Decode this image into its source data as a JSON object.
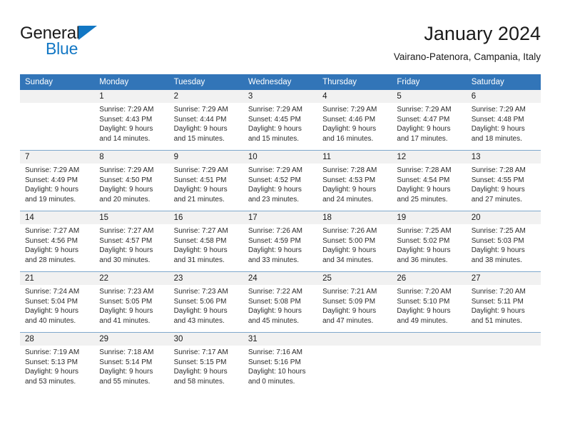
{
  "brand": {
    "name_part1": "General",
    "name_part2": "Blue",
    "triangle_color": "#1277c4",
    "text_color": "#1a1a1a"
  },
  "header": {
    "title": "January 2024",
    "subtitle": "Vairano-Patenora, Campania, Italy"
  },
  "theme": {
    "header_blue": "#3275b8",
    "daynum_band": "#f1f1f1",
    "row_separator": "#7fa8cc"
  },
  "weekday_headers": [
    "Sunday",
    "Monday",
    "Tuesday",
    "Wednesday",
    "Thursday",
    "Friday",
    "Saturday"
  ],
  "weeks": [
    [
      {
        "day": "",
        "sunrise": "",
        "sunset": "",
        "daylight_line1": "",
        "daylight_line2": ""
      },
      {
        "day": "1",
        "sunrise": "Sunrise: 7:29 AM",
        "sunset": "Sunset: 4:43 PM",
        "daylight_line1": "Daylight: 9 hours",
        "daylight_line2": "and 14 minutes."
      },
      {
        "day": "2",
        "sunrise": "Sunrise: 7:29 AM",
        "sunset": "Sunset: 4:44 PM",
        "daylight_line1": "Daylight: 9 hours",
        "daylight_line2": "and 15 minutes."
      },
      {
        "day": "3",
        "sunrise": "Sunrise: 7:29 AM",
        "sunset": "Sunset: 4:45 PM",
        "daylight_line1": "Daylight: 9 hours",
        "daylight_line2": "and 15 minutes."
      },
      {
        "day": "4",
        "sunrise": "Sunrise: 7:29 AM",
        "sunset": "Sunset: 4:46 PM",
        "daylight_line1": "Daylight: 9 hours",
        "daylight_line2": "and 16 minutes."
      },
      {
        "day": "5",
        "sunrise": "Sunrise: 7:29 AM",
        "sunset": "Sunset: 4:47 PM",
        "daylight_line1": "Daylight: 9 hours",
        "daylight_line2": "and 17 minutes."
      },
      {
        "day": "6",
        "sunrise": "Sunrise: 7:29 AM",
        "sunset": "Sunset: 4:48 PM",
        "daylight_line1": "Daylight: 9 hours",
        "daylight_line2": "and 18 minutes."
      }
    ],
    [
      {
        "day": "7",
        "sunrise": "Sunrise: 7:29 AM",
        "sunset": "Sunset: 4:49 PM",
        "daylight_line1": "Daylight: 9 hours",
        "daylight_line2": "and 19 minutes."
      },
      {
        "day": "8",
        "sunrise": "Sunrise: 7:29 AM",
        "sunset": "Sunset: 4:50 PM",
        "daylight_line1": "Daylight: 9 hours",
        "daylight_line2": "and 20 minutes."
      },
      {
        "day": "9",
        "sunrise": "Sunrise: 7:29 AM",
        "sunset": "Sunset: 4:51 PM",
        "daylight_line1": "Daylight: 9 hours",
        "daylight_line2": "and 21 minutes."
      },
      {
        "day": "10",
        "sunrise": "Sunrise: 7:29 AM",
        "sunset": "Sunset: 4:52 PM",
        "daylight_line1": "Daylight: 9 hours",
        "daylight_line2": "and 23 minutes."
      },
      {
        "day": "11",
        "sunrise": "Sunrise: 7:28 AM",
        "sunset": "Sunset: 4:53 PM",
        "daylight_line1": "Daylight: 9 hours",
        "daylight_line2": "and 24 minutes."
      },
      {
        "day": "12",
        "sunrise": "Sunrise: 7:28 AM",
        "sunset": "Sunset: 4:54 PM",
        "daylight_line1": "Daylight: 9 hours",
        "daylight_line2": "and 25 minutes."
      },
      {
        "day": "13",
        "sunrise": "Sunrise: 7:28 AM",
        "sunset": "Sunset: 4:55 PM",
        "daylight_line1": "Daylight: 9 hours",
        "daylight_line2": "and 27 minutes."
      }
    ],
    [
      {
        "day": "14",
        "sunrise": "Sunrise: 7:27 AM",
        "sunset": "Sunset: 4:56 PM",
        "daylight_line1": "Daylight: 9 hours",
        "daylight_line2": "and 28 minutes."
      },
      {
        "day": "15",
        "sunrise": "Sunrise: 7:27 AM",
        "sunset": "Sunset: 4:57 PM",
        "daylight_line1": "Daylight: 9 hours",
        "daylight_line2": "and 30 minutes."
      },
      {
        "day": "16",
        "sunrise": "Sunrise: 7:27 AM",
        "sunset": "Sunset: 4:58 PM",
        "daylight_line1": "Daylight: 9 hours",
        "daylight_line2": "and 31 minutes."
      },
      {
        "day": "17",
        "sunrise": "Sunrise: 7:26 AM",
        "sunset": "Sunset: 4:59 PM",
        "daylight_line1": "Daylight: 9 hours",
        "daylight_line2": "and 33 minutes."
      },
      {
        "day": "18",
        "sunrise": "Sunrise: 7:26 AM",
        "sunset": "Sunset: 5:00 PM",
        "daylight_line1": "Daylight: 9 hours",
        "daylight_line2": "and 34 minutes."
      },
      {
        "day": "19",
        "sunrise": "Sunrise: 7:25 AM",
        "sunset": "Sunset: 5:02 PM",
        "daylight_line1": "Daylight: 9 hours",
        "daylight_line2": "and 36 minutes."
      },
      {
        "day": "20",
        "sunrise": "Sunrise: 7:25 AM",
        "sunset": "Sunset: 5:03 PM",
        "daylight_line1": "Daylight: 9 hours",
        "daylight_line2": "and 38 minutes."
      }
    ],
    [
      {
        "day": "21",
        "sunrise": "Sunrise: 7:24 AM",
        "sunset": "Sunset: 5:04 PM",
        "daylight_line1": "Daylight: 9 hours",
        "daylight_line2": "and 40 minutes."
      },
      {
        "day": "22",
        "sunrise": "Sunrise: 7:23 AM",
        "sunset": "Sunset: 5:05 PM",
        "daylight_line1": "Daylight: 9 hours",
        "daylight_line2": "and 41 minutes."
      },
      {
        "day": "23",
        "sunrise": "Sunrise: 7:23 AM",
        "sunset": "Sunset: 5:06 PM",
        "daylight_line1": "Daylight: 9 hours",
        "daylight_line2": "and 43 minutes."
      },
      {
        "day": "24",
        "sunrise": "Sunrise: 7:22 AM",
        "sunset": "Sunset: 5:08 PM",
        "daylight_line1": "Daylight: 9 hours",
        "daylight_line2": "and 45 minutes."
      },
      {
        "day": "25",
        "sunrise": "Sunrise: 7:21 AM",
        "sunset": "Sunset: 5:09 PM",
        "daylight_line1": "Daylight: 9 hours",
        "daylight_line2": "and 47 minutes."
      },
      {
        "day": "26",
        "sunrise": "Sunrise: 7:20 AM",
        "sunset": "Sunset: 5:10 PM",
        "daylight_line1": "Daylight: 9 hours",
        "daylight_line2": "and 49 minutes."
      },
      {
        "day": "27",
        "sunrise": "Sunrise: 7:20 AM",
        "sunset": "Sunset: 5:11 PM",
        "daylight_line1": "Daylight: 9 hours",
        "daylight_line2": "and 51 minutes."
      }
    ],
    [
      {
        "day": "28",
        "sunrise": "Sunrise: 7:19 AM",
        "sunset": "Sunset: 5:13 PM",
        "daylight_line1": "Daylight: 9 hours",
        "daylight_line2": "and 53 minutes."
      },
      {
        "day": "29",
        "sunrise": "Sunrise: 7:18 AM",
        "sunset": "Sunset: 5:14 PM",
        "daylight_line1": "Daylight: 9 hours",
        "daylight_line2": "and 55 minutes."
      },
      {
        "day": "30",
        "sunrise": "Sunrise: 7:17 AM",
        "sunset": "Sunset: 5:15 PM",
        "daylight_line1": "Daylight: 9 hours",
        "daylight_line2": "and 58 minutes."
      },
      {
        "day": "31",
        "sunrise": "Sunrise: 7:16 AM",
        "sunset": "Sunset: 5:16 PM",
        "daylight_line1": "Daylight: 10 hours",
        "daylight_line2": "and 0 minutes."
      },
      {
        "day": "",
        "sunrise": "",
        "sunset": "",
        "daylight_line1": "",
        "daylight_line2": ""
      },
      {
        "day": "",
        "sunrise": "",
        "sunset": "",
        "daylight_line1": "",
        "daylight_line2": ""
      },
      {
        "day": "",
        "sunrise": "",
        "sunset": "",
        "daylight_line1": "",
        "daylight_line2": ""
      }
    ]
  ]
}
